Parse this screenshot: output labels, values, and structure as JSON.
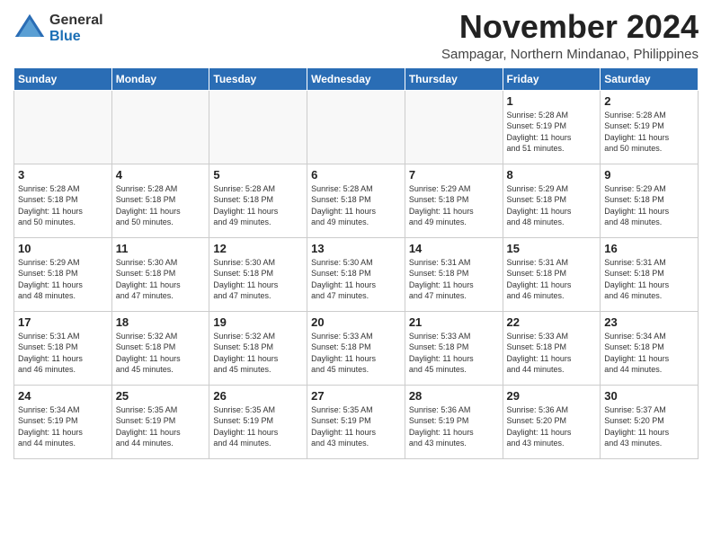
{
  "header": {
    "logo_general": "General",
    "logo_blue": "Blue",
    "month_year": "November 2024",
    "location": "Sampagar, Northern Mindanao, Philippines"
  },
  "weekdays": [
    "Sunday",
    "Monday",
    "Tuesday",
    "Wednesday",
    "Thursday",
    "Friday",
    "Saturday"
  ],
  "weeks": [
    [
      {
        "day": "",
        "info": ""
      },
      {
        "day": "",
        "info": ""
      },
      {
        "day": "",
        "info": ""
      },
      {
        "day": "",
        "info": ""
      },
      {
        "day": "",
        "info": ""
      },
      {
        "day": "1",
        "info": "Sunrise: 5:28 AM\nSunset: 5:19 PM\nDaylight: 11 hours\nand 51 minutes."
      },
      {
        "day": "2",
        "info": "Sunrise: 5:28 AM\nSunset: 5:19 PM\nDaylight: 11 hours\nand 50 minutes."
      }
    ],
    [
      {
        "day": "3",
        "info": "Sunrise: 5:28 AM\nSunset: 5:18 PM\nDaylight: 11 hours\nand 50 minutes."
      },
      {
        "day": "4",
        "info": "Sunrise: 5:28 AM\nSunset: 5:18 PM\nDaylight: 11 hours\nand 50 minutes."
      },
      {
        "day": "5",
        "info": "Sunrise: 5:28 AM\nSunset: 5:18 PM\nDaylight: 11 hours\nand 49 minutes."
      },
      {
        "day": "6",
        "info": "Sunrise: 5:28 AM\nSunset: 5:18 PM\nDaylight: 11 hours\nand 49 minutes."
      },
      {
        "day": "7",
        "info": "Sunrise: 5:29 AM\nSunset: 5:18 PM\nDaylight: 11 hours\nand 49 minutes."
      },
      {
        "day": "8",
        "info": "Sunrise: 5:29 AM\nSunset: 5:18 PM\nDaylight: 11 hours\nand 48 minutes."
      },
      {
        "day": "9",
        "info": "Sunrise: 5:29 AM\nSunset: 5:18 PM\nDaylight: 11 hours\nand 48 minutes."
      }
    ],
    [
      {
        "day": "10",
        "info": "Sunrise: 5:29 AM\nSunset: 5:18 PM\nDaylight: 11 hours\nand 48 minutes."
      },
      {
        "day": "11",
        "info": "Sunrise: 5:30 AM\nSunset: 5:18 PM\nDaylight: 11 hours\nand 47 minutes."
      },
      {
        "day": "12",
        "info": "Sunrise: 5:30 AM\nSunset: 5:18 PM\nDaylight: 11 hours\nand 47 minutes."
      },
      {
        "day": "13",
        "info": "Sunrise: 5:30 AM\nSunset: 5:18 PM\nDaylight: 11 hours\nand 47 minutes."
      },
      {
        "day": "14",
        "info": "Sunrise: 5:31 AM\nSunset: 5:18 PM\nDaylight: 11 hours\nand 47 minutes."
      },
      {
        "day": "15",
        "info": "Sunrise: 5:31 AM\nSunset: 5:18 PM\nDaylight: 11 hours\nand 46 minutes."
      },
      {
        "day": "16",
        "info": "Sunrise: 5:31 AM\nSunset: 5:18 PM\nDaylight: 11 hours\nand 46 minutes."
      }
    ],
    [
      {
        "day": "17",
        "info": "Sunrise: 5:31 AM\nSunset: 5:18 PM\nDaylight: 11 hours\nand 46 minutes."
      },
      {
        "day": "18",
        "info": "Sunrise: 5:32 AM\nSunset: 5:18 PM\nDaylight: 11 hours\nand 45 minutes."
      },
      {
        "day": "19",
        "info": "Sunrise: 5:32 AM\nSunset: 5:18 PM\nDaylight: 11 hours\nand 45 minutes."
      },
      {
        "day": "20",
        "info": "Sunrise: 5:33 AM\nSunset: 5:18 PM\nDaylight: 11 hours\nand 45 minutes."
      },
      {
        "day": "21",
        "info": "Sunrise: 5:33 AM\nSunset: 5:18 PM\nDaylight: 11 hours\nand 45 minutes."
      },
      {
        "day": "22",
        "info": "Sunrise: 5:33 AM\nSunset: 5:18 PM\nDaylight: 11 hours\nand 44 minutes."
      },
      {
        "day": "23",
        "info": "Sunrise: 5:34 AM\nSunset: 5:18 PM\nDaylight: 11 hours\nand 44 minutes."
      }
    ],
    [
      {
        "day": "24",
        "info": "Sunrise: 5:34 AM\nSunset: 5:19 PM\nDaylight: 11 hours\nand 44 minutes."
      },
      {
        "day": "25",
        "info": "Sunrise: 5:35 AM\nSunset: 5:19 PM\nDaylight: 11 hours\nand 44 minutes."
      },
      {
        "day": "26",
        "info": "Sunrise: 5:35 AM\nSunset: 5:19 PM\nDaylight: 11 hours\nand 44 minutes."
      },
      {
        "day": "27",
        "info": "Sunrise: 5:35 AM\nSunset: 5:19 PM\nDaylight: 11 hours\nand 43 minutes."
      },
      {
        "day": "28",
        "info": "Sunrise: 5:36 AM\nSunset: 5:19 PM\nDaylight: 11 hours\nand 43 minutes."
      },
      {
        "day": "29",
        "info": "Sunrise: 5:36 AM\nSunset: 5:20 PM\nDaylight: 11 hours\nand 43 minutes."
      },
      {
        "day": "30",
        "info": "Sunrise: 5:37 AM\nSunset: 5:20 PM\nDaylight: 11 hours\nand 43 minutes."
      }
    ]
  ]
}
